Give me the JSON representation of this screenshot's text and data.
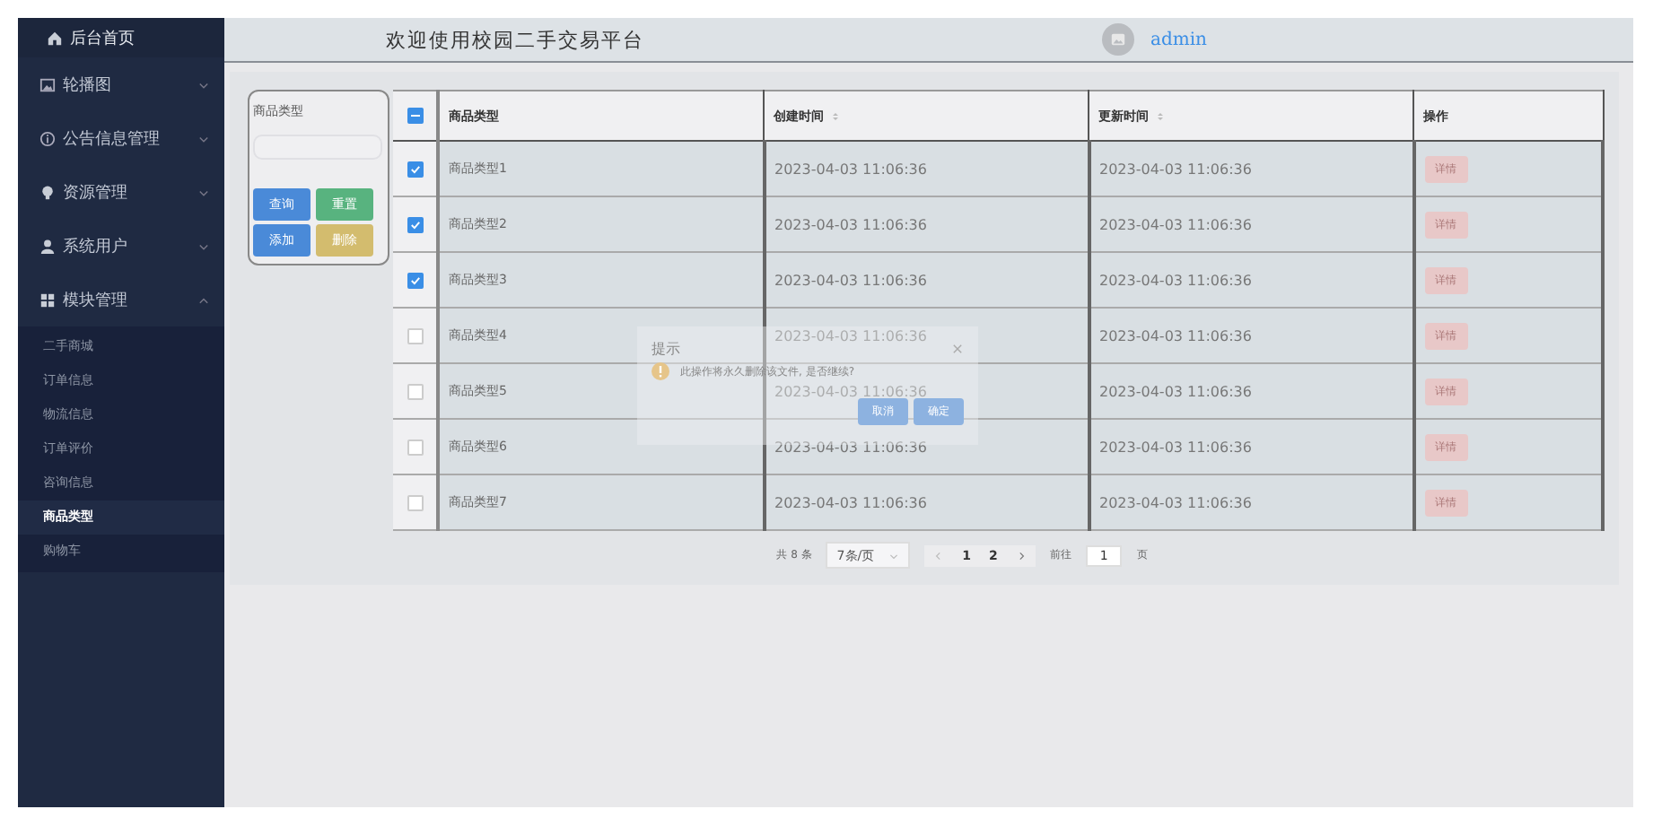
{
  "sidebar": {
    "items": [
      {
        "label": "后台首页",
        "selected": false
      },
      {
        "label": "轮播图",
        "expanded": false,
        "selected": false
      },
      {
        "label": "公告信息管理",
        "expanded": false,
        "selected": false
      },
      {
        "label": "资源管理",
        "expanded": false,
        "selected": false
      },
      {
        "label": "系统用户",
        "expanded": false,
        "selected": false
      },
      {
        "label": "模块管理",
        "expanded": true,
        "selected": false,
        "children": [
          {
            "label": "二手商城",
            "selected": false
          },
          {
            "label": "订单信息",
            "selected": false
          },
          {
            "label": "物流信息",
            "selected": false
          },
          {
            "label": "订单评价",
            "selected": false
          },
          {
            "label": "咨询信息",
            "selected": false
          },
          {
            "label": "商品类型",
            "selected": true
          },
          {
            "label": "购物车",
            "selected": false
          }
        ]
      }
    ]
  },
  "header": {
    "title": "欢迎使用校园二手交易平台",
    "user": "admin"
  },
  "search": {
    "label": "商品类型",
    "buttons": [
      {
        "label": "查询",
        "kind": "primary"
      },
      {
        "label": "重置",
        "kind": "success"
      },
      {
        "label": "添加",
        "kind": "primary"
      },
      {
        "label": "删除",
        "kind": "warning"
      }
    ]
  },
  "table": {
    "indeterminate": true,
    "columns": [
      {
        "label": "商品类型",
        "sortable": false
      },
      {
        "label": "创建时间",
        "sortable": true
      },
      {
        "label": "更新时间",
        "sortable": true
      },
      {
        "label": "操作",
        "sortable": false
      }
    ],
    "rows": [
      {
        "checked": true,
        "name": "商品类型1",
        "created": "2023-04-03 11:06:36",
        "updated": "2023-04-03 11:06:36",
        "action": "详情"
      },
      {
        "checked": true,
        "name": "商品类型2",
        "created": "2023-04-03 11:06:36",
        "updated": "2023-04-03 11:06:36",
        "action": "详情"
      },
      {
        "checked": true,
        "name": "商品类型3",
        "created": "2023-04-03 11:06:36",
        "updated": "2023-04-03 11:06:36",
        "action": "详情"
      },
      {
        "checked": false,
        "name": "商品类型4",
        "created": "2023-04-03 11:06:36",
        "updated": "2023-04-03 11:06:36",
        "action": "详情"
      },
      {
        "checked": false,
        "name": "商品类型5",
        "created": "2023-04-03 11:06:36",
        "updated": "2023-04-03 11:06:36",
        "action": "详情"
      },
      {
        "checked": false,
        "name": "商品类型6",
        "created": "2023-04-03 11:06:36",
        "updated": "2023-04-03 11:06:36",
        "action": "详情"
      },
      {
        "checked": false,
        "name": "商品类型7",
        "created": "2023-04-03 11:06:36",
        "updated": "2023-04-03 11:06:36",
        "action": "详情"
      }
    ]
  },
  "pagination": {
    "total": "共 8 条",
    "page_size": "7条/页",
    "pages": [
      "1",
      "2"
    ],
    "goto_label": "前往",
    "goto_value": "1",
    "goto_suffix": "页"
  },
  "dialog": {
    "title": "提示",
    "message": "此操作将永久删除该文件, 是否继续?",
    "buttons": [
      "取消",
      "确定"
    ]
  }
}
